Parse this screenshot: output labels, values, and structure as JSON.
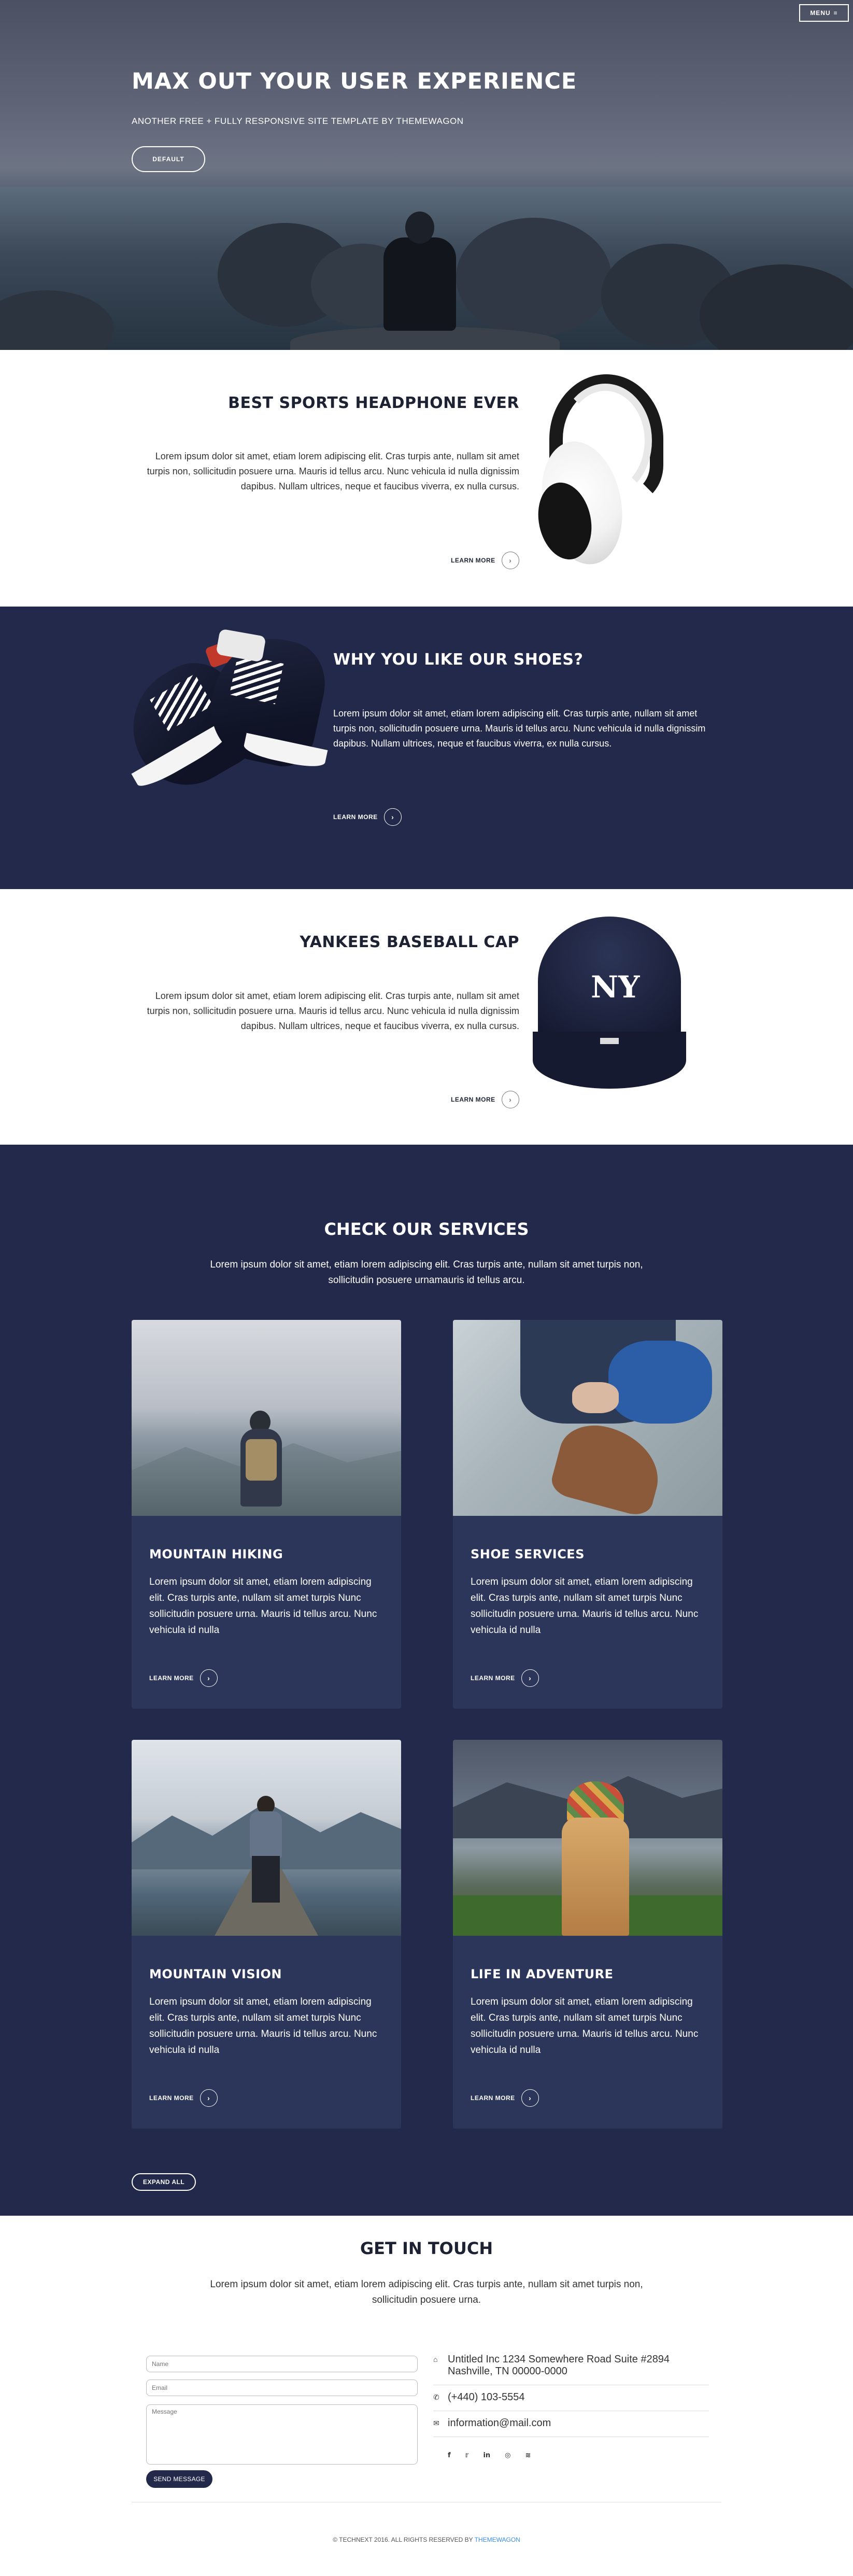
{
  "hero": {
    "menu_label": "MENU",
    "title": "MAX OUT YOUR USER EXPERIENCE",
    "subtitle": "ANOTHER FREE + FULLY RESPONSIVE SITE TEMPLATE BY THEMEWAGON",
    "button_label": "DEFAULT"
  },
  "products": [
    {
      "title": "BEST SPORTS HEADPHONE EVER",
      "body": "Lorem ipsum dolor sit amet, etiam lorem adipiscing elit. Cras turpis ante, nullam sit amet turpis non, sollicitudin posuere urna. Mauris id tellus arcu. Nunc vehicula id nulla dignissim dapibus. Nullam ultrices, neque et faucibus viverra, ex nulla cursus.",
      "link": "LEARN MORE"
    },
    {
      "title": "WHY YOU LIKE OUR SHOES?",
      "body": "Lorem ipsum dolor sit amet, etiam lorem adipiscing elit. Cras turpis ante, nullam sit amet turpis non, sollicitudin posuere urna. Mauris id tellus arcu. Nunc vehicula id nulla dignissim dapibus. Nullam ultrices, neque et faucibus viverra, ex nulla cursus.",
      "link": "LEARN MORE"
    },
    {
      "title": "YANKEES BASEBALL CAP",
      "body": "Lorem ipsum dolor sit amet, etiam lorem adipiscing elit. Cras turpis ante, nullam sit amet turpis non, sollicitudin posuere urna. Mauris id tellus arcu. Nunc vehicula id nulla dignissim dapibus. Nullam ultrices, neque et faucibus viverra, ex nulla cursus.",
      "link": "LEARN MORE"
    }
  ],
  "services": {
    "title": "CHECK OUR SERVICES",
    "description": "Lorem ipsum dolor sit amet, etiam lorem adipiscing elit. Cras turpis ante, nullam sit amet turpis non, sollicitudin posuere urnamauris id tellus arcu.",
    "cards": [
      {
        "title": "MOUNTAIN HIKING",
        "body": "Lorem ipsum dolor sit amet, etiam lorem adipiscing elit. Cras turpis ante, nullam sit amet turpis Nunc sollicitudin posuere urna. Mauris id tellus arcu. Nunc vehicula id nulla",
        "link": "LEARN MORE"
      },
      {
        "title": "SHOE SERVICES",
        "body": "Lorem ipsum dolor sit amet, etiam lorem adipiscing elit. Cras turpis ante, nullam sit amet turpis Nunc sollicitudin posuere urna. Mauris id tellus arcu. Nunc vehicula id nulla",
        "link": "LEARN MORE"
      },
      {
        "title": "MOUNTAIN VISION",
        "body": "Lorem ipsum dolor sit amet, etiam lorem adipiscing elit. Cras turpis ante, nullam sit amet turpis Nunc sollicitudin posuere urna. Mauris id tellus arcu. Nunc vehicula id nulla",
        "link": "LEARN MORE"
      },
      {
        "title": "LIFE IN ADVENTURE",
        "body": "Lorem ipsum dolor sit amet, etiam lorem adipiscing elit. Cras turpis ante, nullam sit amet turpis Nunc sollicitudin posuere urna. Mauris id tellus arcu. Nunc vehicula id nulla",
        "link": "LEARN MORE"
      }
    ],
    "expand_label": "EXPAND ALL"
  },
  "contact": {
    "title": "GET IN TOUCH",
    "description": "Lorem ipsum dolor sit amet, etiam lorem adipiscing elit. Cras turpis ante, nullam sit amet turpis non, sollicitudin posuere urna.",
    "form": {
      "name_placeholder": "Name",
      "email_placeholder": "Email",
      "message_placeholder": "Message",
      "send_label": "SEND MESSAGE"
    },
    "address_line1": "Untitled Inc 1234 Somewhere Road Suite #2894",
    "address_line2": "Nashville, TN 00000-0000",
    "phone": "(+440) 103-5554",
    "email": "information@mail.com",
    "social": [
      "facebook-icon",
      "twitter-icon",
      "linkedin-icon",
      "dribbble-icon",
      "rss-icon"
    ]
  },
  "footer": {
    "text": "© TECHNEXT 2016. ALL RIGHTS RESERVED BY",
    "brand": "THEMEWAGON"
  },
  "colors": {
    "navy": "#23294a",
    "card": "#2c355a",
    "link_blue": "#3a8ee6"
  }
}
